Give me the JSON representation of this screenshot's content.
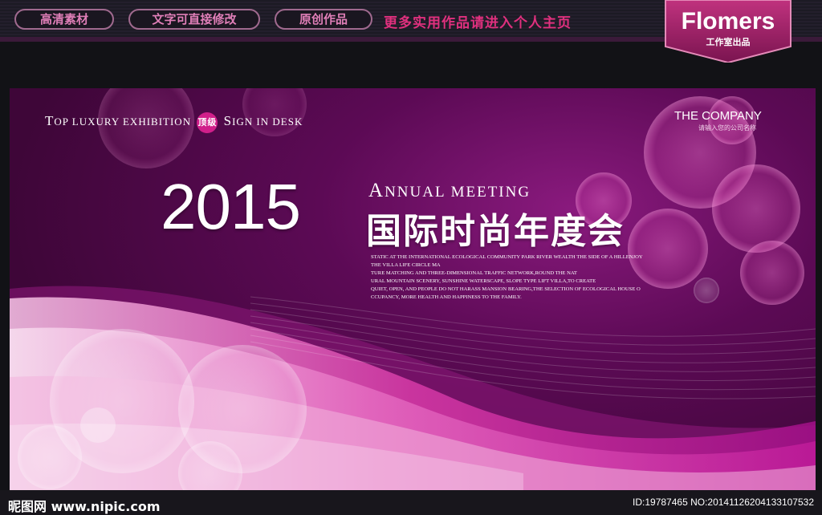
{
  "top_nav": {
    "pills": [
      "高清素材",
      "文字可直接修改",
      "原创作品"
    ],
    "promo": "更多实用作品请进入个人主页"
  },
  "brand": {
    "name": "Flomers",
    "subtitle": "工作室出品"
  },
  "banner": {
    "tagline_left_cap": "T",
    "tagline_left_rest": "OP LUXURY EXHIBITION",
    "badge": "顶级",
    "tagline_right_cap": "S",
    "tagline_right_rest": "IGN IN DESK",
    "company": "THE COMPANY",
    "company_sub": "请输入您的公司名称",
    "year": "2015",
    "annual_cap": "A",
    "annual_rest": "NNUAL MEETING",
    "cn_title": "国际时尚年度会",
    "description": [
      "STATIC AT THE INTERNATIONAL ECOLOGICAL COMMUNITY PARK RIVER WEALTH THE SIDE OF A HILLENJOY",
      "THE VILLA LIFE CIRCLE MA",
      "TURE MATCHING AND THREE-DIMENSIONAL TRAFFIC NETWORK,ROUND THE NAT",
      "URAL MOUNTAIN SCENERY, SUNSHINE WATERSCAPE, SLOPE TYPE LIFT VILLA,TO CREATE",
      "QUIET, OPEN, AND PEOPLE DO NOT HARASS MANSION BEARING,THE SELECTION OF ECOLOGICAL HOUSE O",
      "CCUPANCY, MORE HEALTH AND HAPPINESS TO THE FAMILY."
    ]
  },
  "footer": {
    "watermark": "昵图网 www.nipic.com",
    "image_id": "ID:19787465 NO:20141126204133107532"
  },
  "colors": {
    "accent": "#d01f8a",
    "promo": "#e0307e",
    "background": "#5c0a55"
  }
}
